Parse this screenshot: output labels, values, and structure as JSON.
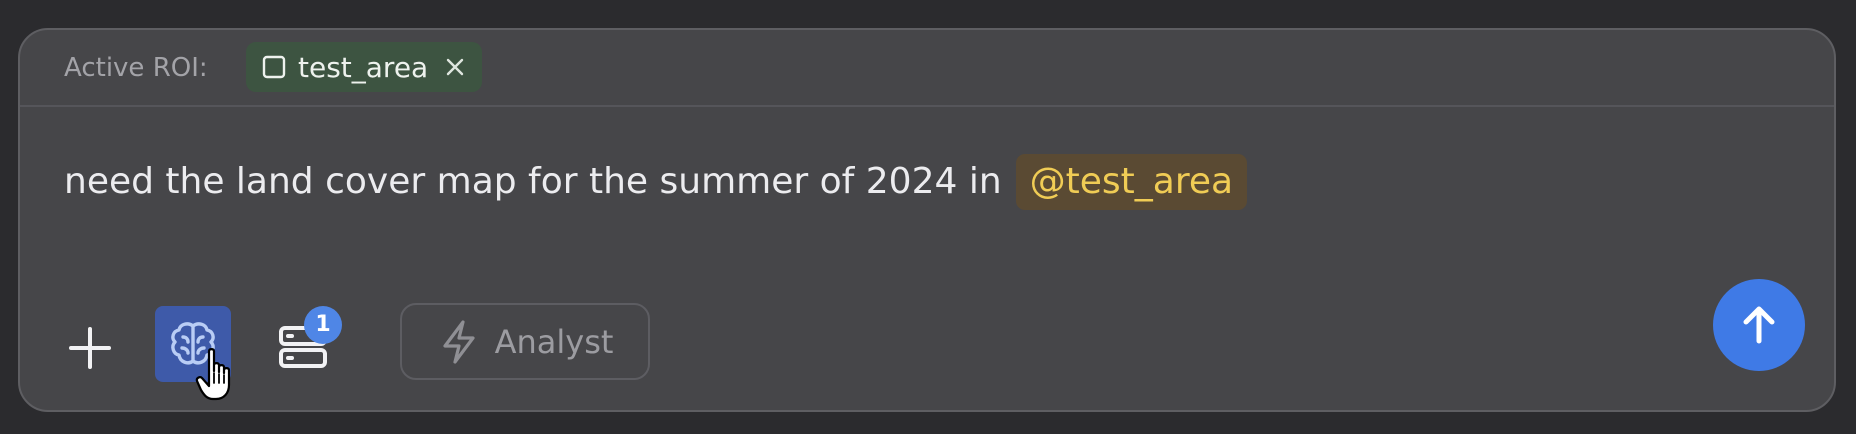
{
  "roi": {
    "label": "Active ROI:",
    "chip_text": "test_area",
    "chip_icon": "square-icon",
    "close_icon": "close-icon"
  },
  "prompt": {
    "text": "need the land cover map for the summer of 2024 in",
    "mention": "@test_area"
  },
  "toolbar": {
    "add_icon": "plus-icon",
    "brain_icon": "brain-icon",
    "layers_icon": "layers-icon",
    "layers_badge": "1",
    "mode_icon": "lightning-icon",
    "mode_label": "Analyst",
    "send_icon": "arrow-up-icon"
  },
  "colors": {
    "background": "#2b2b2e",
    "panel": "#464649",
    "chip_bg": "#3d5441",
    "mention_bg": "#5a4a33",
    "mention_text": "#f0cc55",
    "brain_active": "#3e5aa9",
    "accent": "#3f7ae6"
  }
}
